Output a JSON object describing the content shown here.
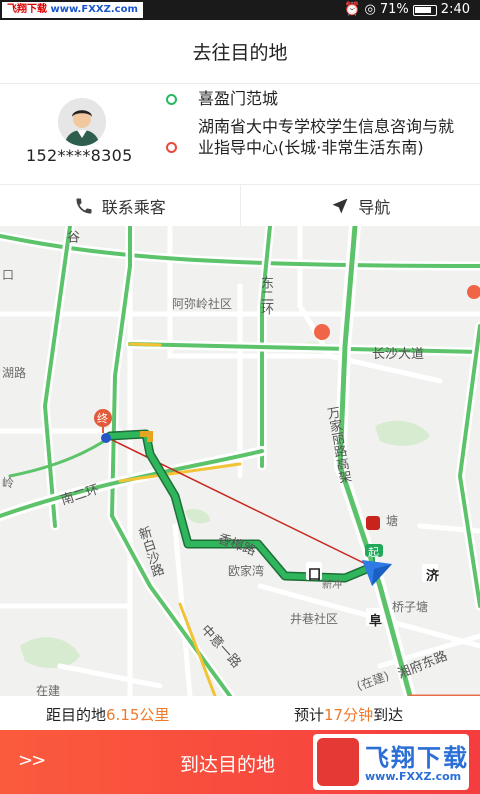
{
  "status_bar": {
    "watermark_left": "飞翔下载",
    "watermark_url": "www.FXXZ.com",
    "battery": "71%",
    "time": "2:40"
  },
  "header": {
    "title": "去往目的地"
  },
  "passenger": {
    "phone": "152****8305",
    "start": "喜盈门范城",
    "destination": "湖南省大中专学校学生信息咨询与就业指导中心(长城·非常生活东南)"
  },
  "actions": {
    "contact": "联系乘客",
    "navigate": "导航"
  },
  "map": {
    "labels": {
      "amiling": "阿弥岭社区",
      "changsha_avenue": "长沙大道",
      "wanjiali": "万家丽路高架",
      "xiangzhang": "香樟路",
      "south_ring": "南二环",
      "xinbai": "新白沙路",
      "zhongyi": "中意一路",
      "huanan_road": "湖路",
      "jingxiang": "井巷社区",
      "ojiawan": "欧家湾",
      "huazi": "桥子塘",
      "xiangfu_east": "湘府东路",
      "zaijian": "在建",
      "dong_huan": "东二环",
      "tang": "塘",
      "jihu": "济",
      "qiu": "囗",
      "huai": "阜",
      "xinzhu": "新冲",
      "zaijian2": "(在建)",
      "ling": "岭",
      "gu": "谷",
      "kou": "口",
      "zhongdian": "终",
      "qidian": "起"
    }
  },
  "eta": {
    "distance_prefix": "距目的地",
    "distance_value": "6.15公里",
    "time_prefix": "预计",
    "time_value": "17分钟",
    "time_suffix": "到达"
  },
  "cta": {
    "chevron": ">>",
    "label": "到达目的地",
    "watermark_brand": "飞翔下载",
    "watermark_domain": "www.FXXZ.com"
  },
  "colors": {
    "accent": "#f07a2c",
    "cta_red": "#f53c3e",
    "route_green": "#2f9e4f",
    "start_dot": "#27b760",
    "end_dot": "#e9493a"
  }
}
